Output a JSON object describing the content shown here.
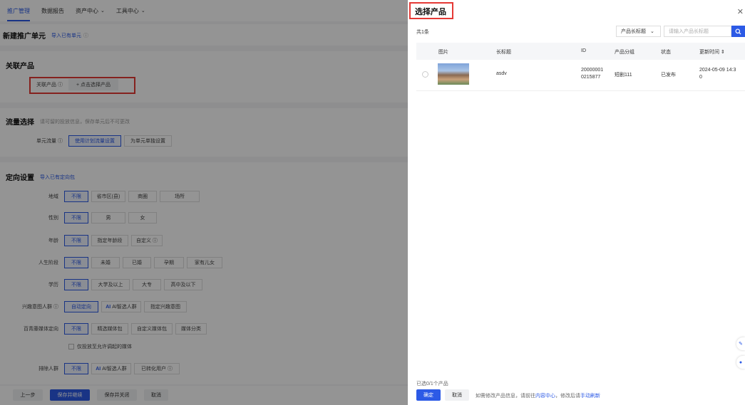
{
  "nav": {
    "items": [
      {
        "label": "推广管理",
        "active": true
      },
      {
        "label": "数据报告"
      },
      {
        "label": "资产中心",
        "has_dropdown": true
      },
      {
        "label": "工具中心",
        "has_dropdown": true
      }
    ]
  },
  "page": {
    "title": "新建推广单元",
    "import_link": "导入已有单元"
  },
  "product_section": {
    "title": "关联产品",
    "label": "关联产品",
    "select_button": "+ 点击选择产品"
  },
  "traffic_section": {
    "title": "流量选择",
    "subtitle": "请可留的投放信息，保存单元后不可更改",
    "label": "单元流量",
    "options": [
      "使用计划流量设置",
      "为单元单独设置"
    ]
  },
  "targeting_section": {
    "title": "定向设置",
    "import_link": "导入已有定向包",
    "rows": [
      {
        "label": "地域",
        "options": [
          "不限",
          "省市区(县)",
          "商圈",
          "场所"
        ]
      },
      {
        "label": "性别",
        "options": [
          "不限",
          "男",
          "女"
        ]
      },
      {
        "label": "年龄",
        "options": [
          "不限",
          "指定年龄段",
          "自定义 ⓘ"
        ]
      },
      {
        "label": "人生阶段",
        "options": [
          "不限",
          "未婚",
          "已婚",
          "孕期",
          "家有儿女"
        ]
      },
      {
        "label": "学历",
        "options": [
          "不限",
          "大学及以上",
          "大专",
          "高中及以下"
        ]
      },
      {
        "label": "兴趣意图人群",
        "options": [
          "自动定向",
          "AI智选人群",
          "指定兴趣意图"
        ]
      },
      {
        "label": "百青藤媒体定向",
        "options": [
          "不限",
          "精选媒体包",
          "自定义媒体包",
          "媒体分类"
        ]
      },
      {
        "label": "排除人群",
        "options": [
          "不限",
          "AI智选人群",
          "已转化用户 ⓘ"
        ]
      }
    ],
    "media_checkbox": "仅投放至允许调起的媒体"
  },
  "footer": {
    "prev": "上一步",
    "save_continue": "保存并继续",
    "save_close": "保存并关闭",
    "cancel": "取消"
  },
  "drawer": {
    "title": "选择产品",
    "count": "共1条",
    "filter_select": "产品长标题",
    "search_placeholder": "请输入产品长标题",
    "columns": [
      "图片",
      "长标题",
      "ID",
      "产品分组",
      "状态",
      "更新时间 ⇕"
    ],
    "rows": [
      {
        "title": "asdv",
        "id_line1": "20000001",
        "id_line2": "0215877",
        "group": "短剧111",
        "status": "已发布",
        "updated_line1": "2024-05-09 14:3",
        "updated_line2": "0"
      }
    ],
    "selected_count": "已选0/1个产品",
    "ok": "确定",
    "cancel": "取消",
    "hint_prefix": "如需修改产品信息，请前往",
    "hint_link1": "内容中心",
    "hint_mid": "，修改后请",
    "hint_link2": "手动刷新"
  },
  "colors": {
    "accent": "#2c5ae6",
    "highlight": "#e53935"
  }
}
